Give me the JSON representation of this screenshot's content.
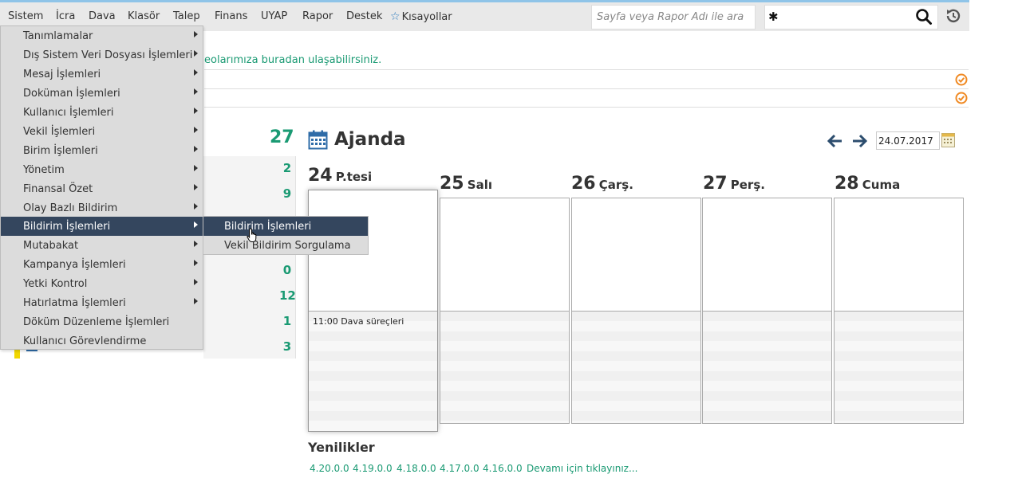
{
  "menubar": {
    "items": [
      "Sistem",
      "İcra",
      "Dava",
      "Klasör",
      "Talep",
      "Finans",
      "UYAP",
      "Rapor",
      "Destek"
    ],
    "shortcuts_label": "Kısayollar",
    "search_placeholder": "Sayfa veya Rapor Adı ile ara"
  },
  "info": {
    "text": "eolarımıza buradan ulaşabilirsiniz."
  },
  "counts": {
    "header": "27",
    "values": [
      "2",
      "9",
      "0",
      "12",
      "1",
      "3"
    ]
  },
  "dropdown": {
    "items": [
      {
        "label": "Tanımlamalar",
        "arrow": true
      },
      {
        "label": "Dış Sistem Veri Dosyası İşlemleri",
        "arrow": true
      },
      {
        "label": "Mesaj İşlemleri",
        "arrow": true
      },
      {
        "label": "Doküman İşlemleri",
        "arrow": true
      },
      {
        "label": "Kullanıcı İşlemleri",
        "arrow": true
      },
      {
        "label": "Vekil İşlemleri",
        "arrow": true
      },
      {
        "label": "Birim İşlemleri",
        "arrow": true
      },
      {
        "label": "Yönetim",
        "arrow": true
      },
      {
        "label": "Finansal Özet",
        "arrow": true
      },
      {
        "label": "Olay Bazlı Bildirim",
        "arrow": true
      },
      {
        "label": "Bildirim İşlemleri",
        "arrow": true
      },
      {
        "label": "Mutabakat",
        "arrow": true
      },
      {
        "label": "Kampanya İşlemleri",
        "arrow": true
      },
      {
        "label": "Yetki Kontrol",
        "arrow": true
      },
      {
        "label": "Hatırlatma İşlemleri",
        "arrow": true
      },
      {
        "label": "Döküm Düzenleme İşlemleri",
        "arrow": false
      },
      {
        "label": "Kullanıcı Görevlendirme",
        "arrow": false
      }
    ],
    "submenu": [
      "Bildirim İşlemleri",
      "Vekil Bildirim Sorgulama"
    ]
  },
  "agenda": {
    "title": "Ajanda",
    "date": "24.07.2017",
    "days": [
      {
        "num": "24",
        "name": "P.tesi"
      },
      {
        "num": "25",
        "name": "Salı"
      },
      {
        "num": "26",
        "name": "Çarş."
      },
      {
        "num": "27",
        "name": "Perş."
      },
      {
        "num": "28",
        "name": "Cuma"
      }
    ],
    "event": "11:00 Dava süreçleri"
  },
  "news": {
    "title": "Yenilikler",
    "versions": [
      "4.20.0.0",
      "4.19.0.0",
      "4.18.0.0",
      "4.17.0.0",
      "4.16.0.0"
    ],
    "more": "Devamı için tıklayınız..."
  },
  "colors": {
    "accent_green": "#1a9a73",
    "menu_hover": "#34465e",
    "check_orange": "#f08a24"
  }
}
